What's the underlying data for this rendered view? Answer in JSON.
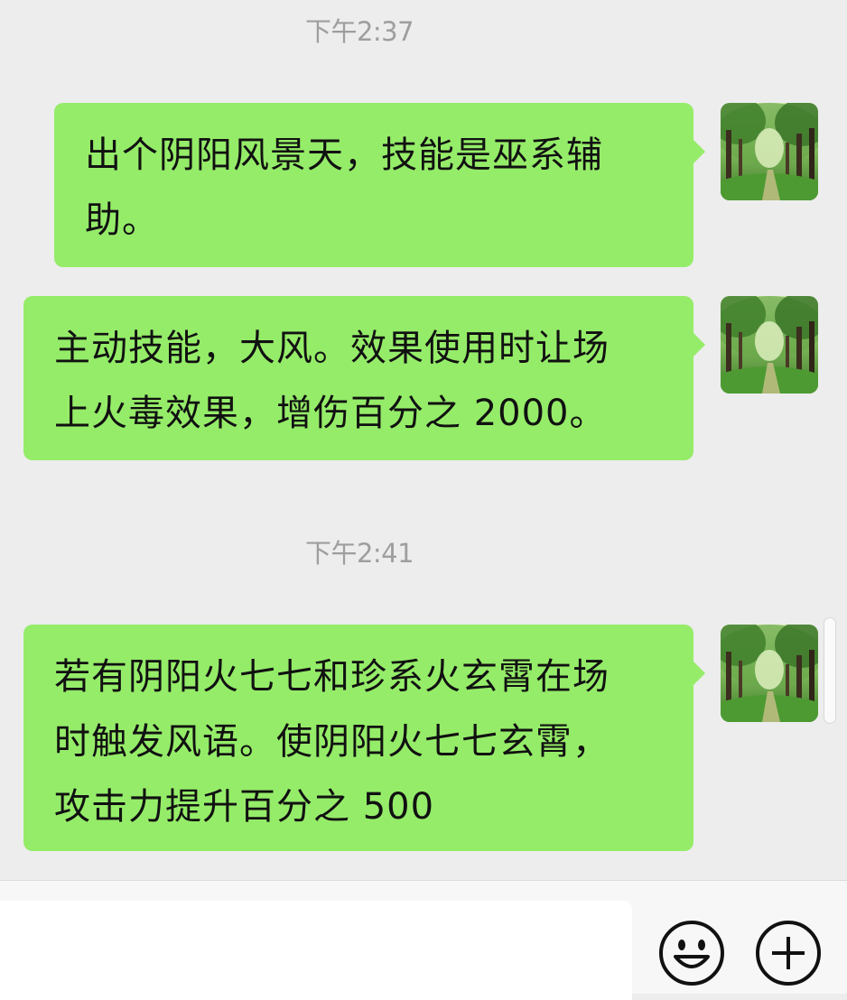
{
  "timestamps": [
    "下午2:37",
    "下午2:41"
  ],
  "messages": [
    {
      "lines": [
        "出个阴阳风景天，技能是巫系辅",
        "助。"
      ]
    },
    {
      "lines": [
        "主动技能，大风。效果使用时让场",
        "上火毒效果，增伤百分之 2000。"
      ]
    },
    {
      "lines": [
        "若有阴阳火七七和珍系火玄霄在场",
        "时触发风语。使阴阳火七七玄霄，",
        "攻击力提升百分之 500"
      ]
    }
  ],
  "input": {
    "value": "",
    "placeholder": ""
  },
  "icons": {
    "emoji": "smiley-face-icon",
    "plus": "plus-circle-icon",
    "avatar": "forest-path-avatar"
  },
  "colors": {
    "bubble": "#95ec69",
    "background": "#ededed",
    "timestamp": "#9e9e9e"
  }
}
